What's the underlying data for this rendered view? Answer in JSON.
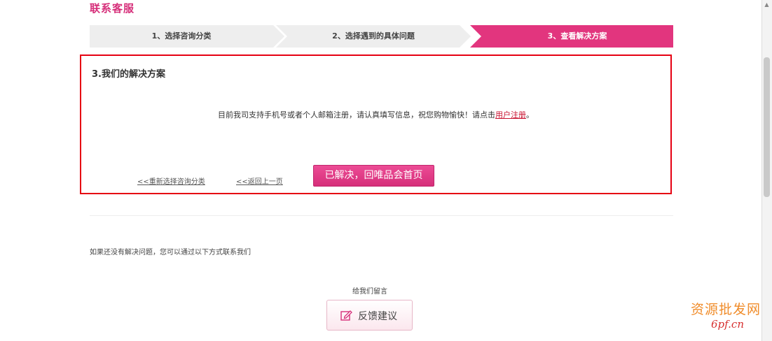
{
  "page": {
    "title": "联系客服"
  },
  "steps": [
    {
      "label": "1、选择咨询分类",
      "active": false
    },
    {
      "label": "2、选择遇到的具体问题",
      "active": false
    },
    {
      "label": "3、查看解决方案",
      "active": true
    }
  ],
  "solution": {
    "heading": "3.我们的解决方案",
    "text_before": "目前我司支持手机号或者个人邮箱注册，请认真填写信息，祝您购物愉快！请点击",
    "link": "用户注册",
    "text_after": "。",
    "reselect_link": "<<重新选择咨询分类",
    "back_link": "<<返回上一页",
    "resolved_button": "已解决，回唯品会首页"
  },
  "help": {
    "text": "如果还没有解决问题，您可以通过以下方式联系我们",
    "leave_message": "给我们留言",
    "feedback_button": "反馈建议"
  },
  "watermark": {
    "line1": "资源批发网",
    "url": "6pf.cn"
  },
  "colors": {
    "accent": "#d62f7a",
    "border": "#e60012",
    "step_inactive": "#eeeeee"
  }
}
